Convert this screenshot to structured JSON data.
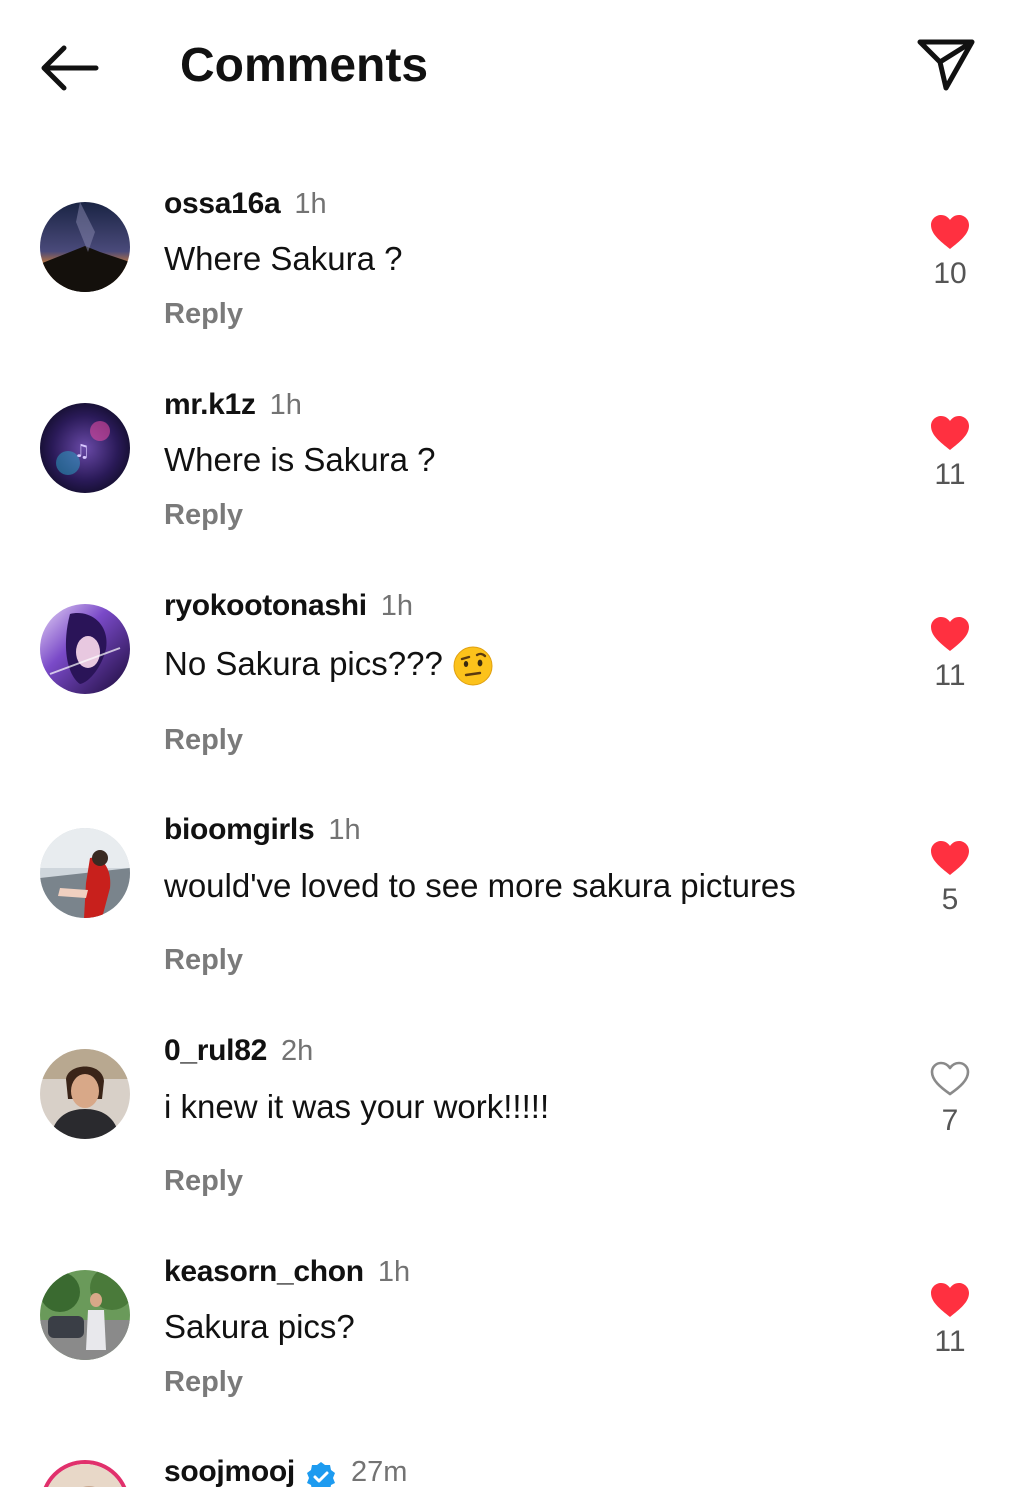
{
  "header": {
    "title": "Comments",
    "back_icon": "arrow-left-icon",
    "share_icon": "paper-plane-icon"
  },
  "colors": {
    "heart": "#ff3040",
    "verified": "#1d9bf0",
    "muted": "#737373"
  },
  "comments": [
    {
      "username": "ossa16a",
      "time": "1h",
      "text": "Where Sakura ?",
      "reply": "Reply",
      "likes": "10",
      "liked": true
    },
    {
      "username": "mr.k1z",
      "time": "1h",
      "text": "Where is Sakura ?",
      "reply": "Reply",
      "likes": "11",
      "liked": true
    },
    {
      "username": "ryokootonashi",
      "time": "1h",
      "text": "No Sakura pics???",
      "emoji": "raised-eyebrow-face-icon",
      "reply": "Reply",
      "likes": "11",
      "liked": true
    },
    {
      "username": "bioomgirls",
      "time": "1h",
      "text": "would've loved to see more sakura pictures",
      "reply": "Reply",
      "likes": "5",
      "liked": true
    },
    {
      "username": "0_rul82",
      "time": "2h",
      "text": "i knew it was your work!!!!!",
      "reply": "Reply",
      "likes": "7",
      "liked": false
    },
    {
      "username": "keasorn_chon",
      "time": "1h",
      "text": "Sakura pics?",
      "reply": "Reply",
      "likes": "11",
      "liked": true
    },
    {
      "username": "soojmooj",
      "time": "27m",
      "verified": true
    }
  ]
}
